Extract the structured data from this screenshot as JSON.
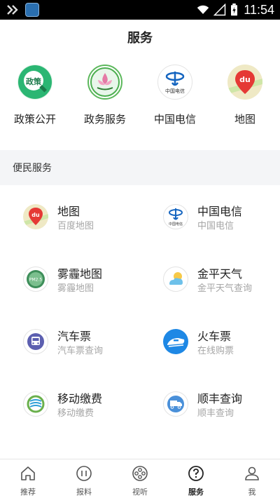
{
  "status_bar": {
    "time": "11:54"
  },
  "header": {
    "title": "服务"
  },
  "shortcuts": [
    {
      "label": "政策公开",
      "icon": "policy-icon",
      "badge": "政策"
    },
    {
      "label": "政务服务",
      "icon": "government-service-icon"
    },
    {
      "label": "中国电信",
      "icon": "china-telecom-icon",
      "logo_text": "中国电信"
    },
    {
      "label": "地图",
      "icon": "baidu-map-icon",
      "logo_text": "du"
    }
  ],
  "section": {
    "title": "便民服务"
  },
  "services": [
    {
      "title": "地图",
      "subtitle": "百度地图",
      "icon": "baidu-map-icon",
      "logo_text": "du"
    },
    {
      "title": "中国电信",
      "subtitle": "中国电信",
      "icon": "china-telecom-icon",
      "logo_text": "中国电信"
    },
    {
      "title": "雾霾地图",
      "subtitle": "雾霾地图",
      "icon": "smog-map-icon",
      "logo_text": "PM2.5"
    },
    {
      "title": "金平天气",
      "subtitle": "金平天气查询",
      "icon": "weather-icon"
    },
    {
      "title": "汽车票",
      "subtitle": "汽车票查询",
      "icon": "bus-ticket-icon"
    },
    {
      "title": "火车票",
      "subtitle": "在线购票",
      "icon": "train-ticket-icon"
    },
    {
      "title": "移动缴费",
      "subtitle": "移动缴费",
      "icon": "china-mobile-icon"
    },
    {
      "title": "顺丰查询",
      "subtitle": "顺丰查询",
      "icon": "sf-express-icon"
    }
  ],
  "tabs": [
    {
      "label": "推荐",
      "icon": "home-icon",
      "active": false
    },
    {
      "label": "报料",
      "icon": "report-icon",
      "active": false
    },
    {
      "label": "视听",
      "icon": "film-reel-icon",
      "active": false
    },
    {
      "label": "服务",
      "icon": "service-icon",
      "active": true
    },
    {
      "label": "我",
      "icon": "user-icon",
      "active": false
    }
  ],
  "colors": {
    "accent_blue": "#1e88e5",
    "telecom_blue": "#1565c0",
    "policy_green": "#22a366",
    "map_red": "#e53935",
    "section_bg": "#f4f5f7"
  }
}
